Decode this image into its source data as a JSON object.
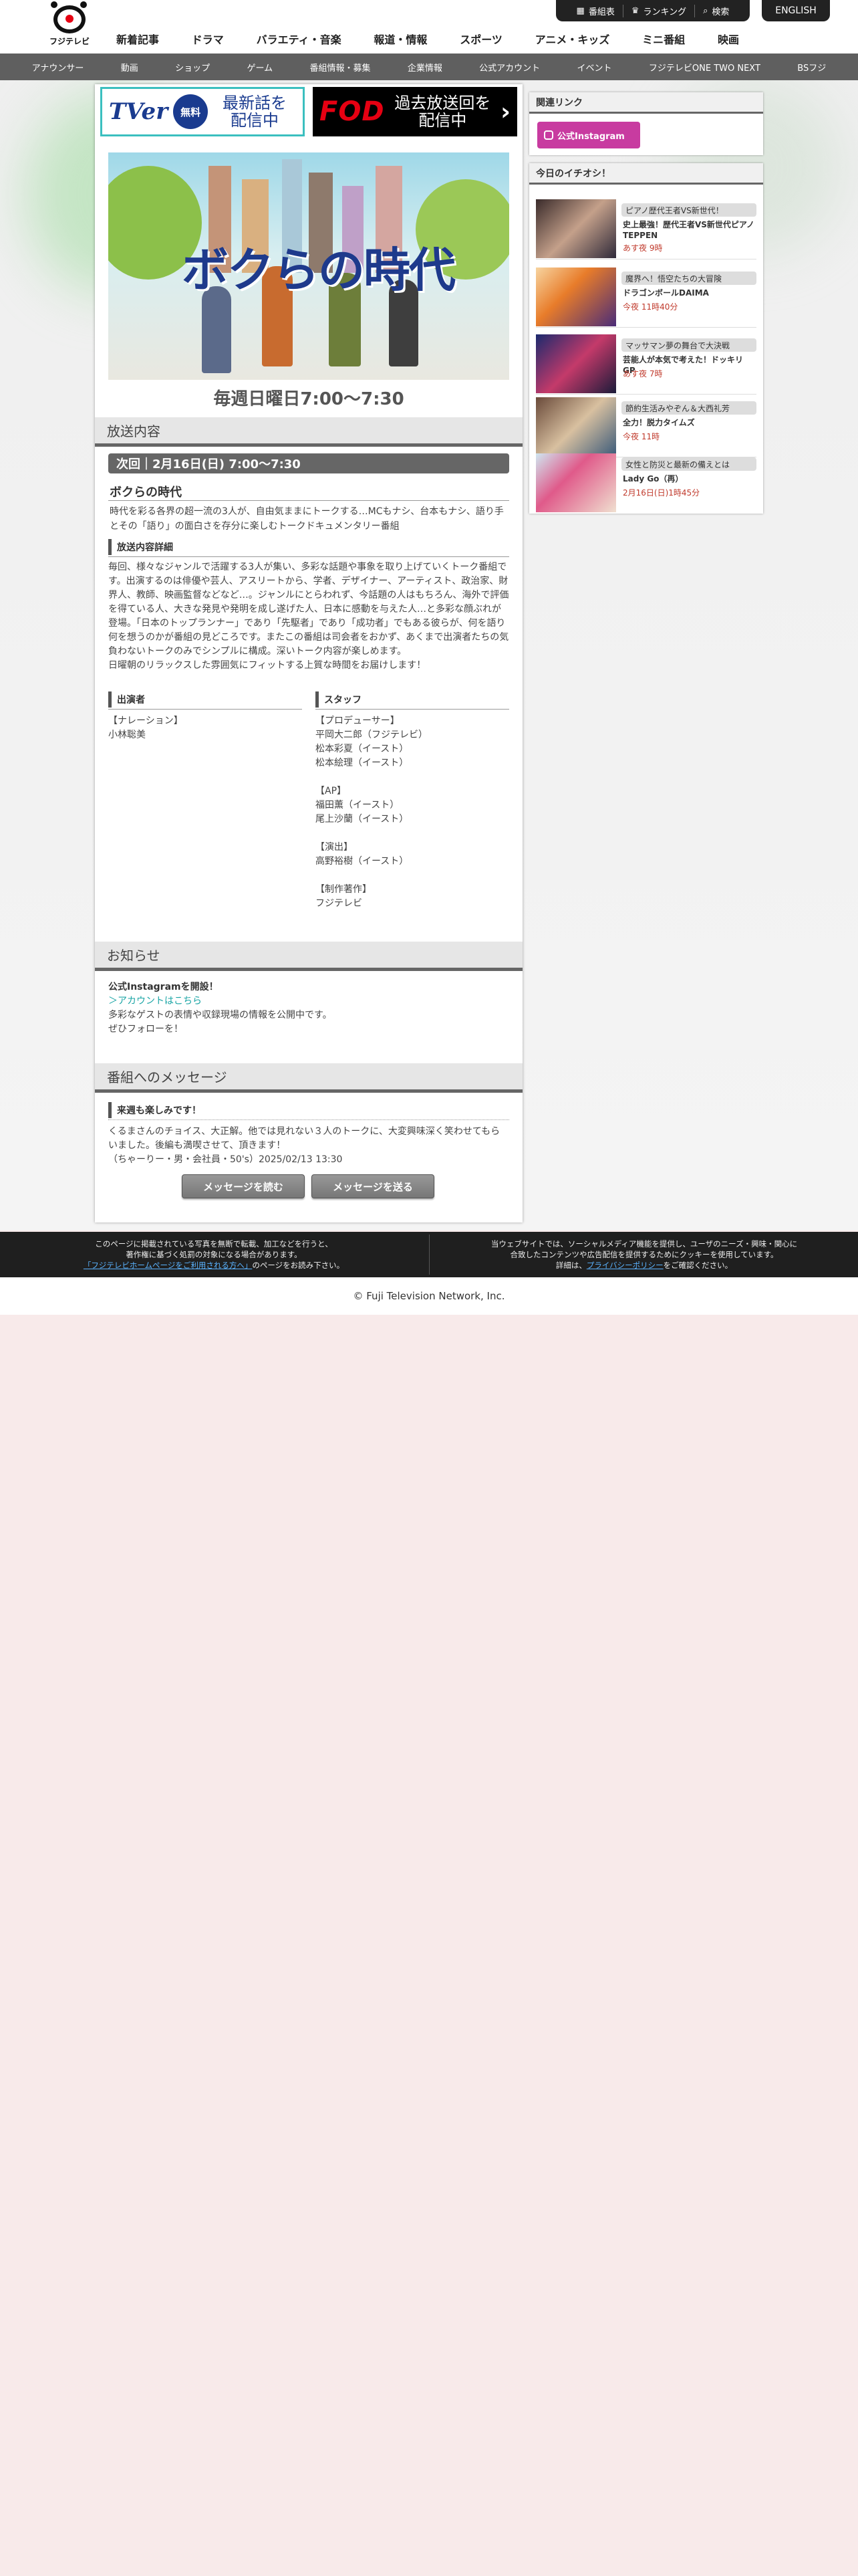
{
  "header": {
    "logo_text": "フジテレビ",
    "util_links": [
      {
        "icon": "grid-icon",
        "label": "番組表"
      },
      {
        "icon": "crown-icon",
        "label": "ランキング"
      },
      {
        "icon": "search-icon",
        "label": "検索"
      }
    ],
    "english_label": "ENGLISH",
    "main_nav": [
      "新着記事",
      "ドラマ",
      "バラエティ・音楽",
      "報道・情報",
      "スポーツ",
      "アニメ・キッズ",
      "ミニ番組",
      "映画"
    ],
    "sub_nav": [
      "アナウンサー",
      "動画",
      "ショップ",
      "ゲーム",
      "番組情報・募集",
      "企業情報",
      "公式アカウント",
      "イベント",
      "フジテレビONE TWO NEXT",
      "BSフジ"
    ]
  },
  "banners": {
    "tver": {
      "logo": "TVer",
      "badge": "無料",
      "text_line1": "最新話を",
      "text_line2": "配信中"
    },
    "fod": {
      "logo": "FOD",
      "text_line1": "過去放送回を",
      "text_line2": "配信中"
    }
  },
  "hero": {
    "title": "ボクらの時代",
    "schedule": "毎週日曜日7:00〜7:30"
  },
  "broadcast": {
    "section_title": "放送内容",
    "next_label": "次回｜2月16日(日) 7:00〜7:30",
    "program_title": "ボクらの時代",
    "lead": "時代を彩る各界の超一流の3人が、自由気ままにトークする…MCもナシ、台本もナシ、語り手とその「語り」の面白さを存分に楽しむトークドキュメンタリー番組",
    "detail_title": "放送内容詳細",
    "detail_lines": [
      "毎回、様々なジャンルで活躍する3人が集い、多彩な話題や事象を取り上げていくトーク番組です。出演するのは俳優や芸人、アスリートから、学者、デザイナー、アーティスト、政治家、財界人、教師、映画監督などなど…。ジャンルにとらわれず、今話題の人はもちろん、海外で評価を得ている人、大きな発見や発明を成し遂げた人、日本に感動を与えた人…と多彩な顔ぶれが登場。「日本のトップランナー」であり「先駆者」であり「成功者」でもある彼らが、何を語り何を想うのかが番組の見どころです。またこの番組は司会者をおかず、あくまで出演者たちの気負わないトークのみでシンプルに構成。深いトーク内容が楽しめます。",
      "日曜朝のリラックスした雰囲気にフィットする上質な時間をお届けします！"
    ],
    "cast_title": "出演者",
    "cast_lines": [
      "【ナレーション】",
      "小林聡美"
    ],
    "staff_title": "スタッフ",
    "staff_lines": [
      "【プロデューサー】",
      "平岡大二郎（フジテレビ）",
      "松本彩夏（イースト）",
      "松本絵理（イースト）",
      "",
      "【AP】",
      "福田薫（イースト）",
      "尾上沙蘭（イースト）",
      "",
      "【演出】",
      "高野裕樹（イースト）",
      "",
      "【制作著作】",
      "フジテレビ"
    ]
  },
  "notice": {
    "section_title": "お知らせ",
    "headline": "公式Instagramを開設！",
    "link_text": "＞アカウントはこちら",
    "lines": [
      "多彩なゲストの表情や収録現場の情報を公開中です。",
      "ぜひフォローを！"
    ]
  },
  "messages": {
    "section_title": "番組へのメッセージ",
    "item_title": "来週も楽しみです！",
    "item_body": "くるまさんのチョイス、大正解。他では見れない３人のトークに、大変興味深く笑わせてもらいました。後編も満喫させて、頂きます！",
    "item_meta": "（ちゃーりー・男・会社員・50's）2025/02/13 13:30",
    "read_button": "メッセージを読む",
    "send_button": "メッセージを送る"
  },
  "sidebar": {
    "related_title": "関連リンク",
    "instagram_label": "公式Instagram",
    "pick_title": "今日のイチオシ！",
    "picks": [
      {
        "tag": "ピアノ歴代王者VS新世代！",
        "title": "史上最強！歴代王者VS新世代ピアノTEPPEN",
        "time": "あす夜 9時"
      },
      {
        "tag": "魔界へ！悟空たちの大冒険",
        "title": "ドラゴンボールDAIMA",
        "time": "今夜 11時40分"
      },
      {
        "tag": "マッサマン夢の舞台で大決戦",
        "title": "芸能人が本気で考えた！ドッキリGP",
        "time": "あす夜 7時"
      },
      {
        "tag": "節約生活みやぞん＆大西礼芳",
        "title": "全力！脱力タイムズ",
        "time": "今夜 11時"
      },
      {
        "tag": "女性と防災と最新の備えとは",
        "title": "Lady Go（再）",
        "time": "2月16日(日)1時45分"
      }
    ]
  },
  "footer": {
    "left_lines": [
      "このページに掲載されている写真を無断で転載、加工などを行うと、",
      "著作権に基づく処罰の対象になる場合があります。"
    ],
    "left_link": "「フジテレビホームページをご利用される方へ」",
    "left_tail": "のページをお読み下さい。",
    "right_lines": [
      "当ウェブサイトでは、ソーシャルメディア機能を提供し、ユーザのニーズ・興味・関心に",
      "合致したコンテンツや広告配信を提供するためにクッキーを使用しています。"
    ],
    "right_prefix": "詳細は、",
    "right_link": "プライバシーポリシー",
    "right_tail": "をご確認ください。",
    "copyright": "© Fuji Television Network, Inc."
  }
}
